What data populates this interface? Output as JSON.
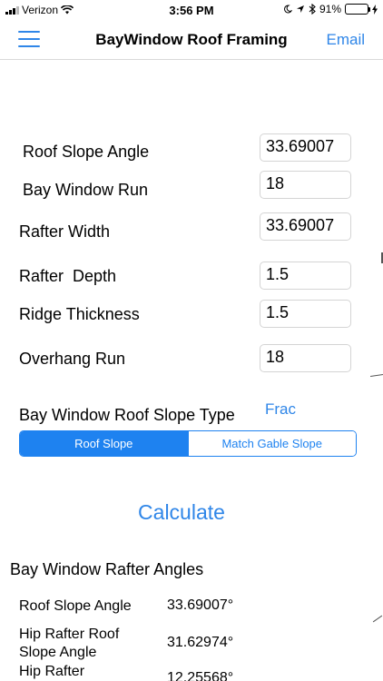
{
  "status_bar": {
    "carrier": "Verizon",
    "time": "3:56 PM",
    "battery": "91%",
    "battery_level": 0.91
  },
  "navbar": {
    "title": "BayWindow Roof Framing",
    "email_label": "Email",
    "menu_icon": "hamburger-menu-icon"
  },
  "inputs": {
    "roof_slope_angle": {
      "label": "Roof Slope Angle",
      "value": "33.69007"
    },
    "bay_window_run": {
      "label": "Bay Window Run",
      "value": "18"
    },
    "rafter_width": {
      "label": "Rafter Width",
      "value": "33.69007"
    },
    "rafter_depth": {
      "label": "Rafter  Depth",
      "value": "1.5"
    },
    "ridge_thickness": {
      "label": "Ridge Thickness",
      "value": "1.5"
    },
    "overhang_run": {
      "label": "Overhang Run",
      "value": "18"
    }
  },
  "slope_type": {
    "label": "Bay Window Roof Slope Type",
    "frac_label": "Frac",
    "options": [
      "Roof Slope",
      "Match Gable Slope"
    ],
    "selected": "Roof Slope"
  },
  "calculate_label": "Calculate",
  "results": {
    "heading": "Bay Window Rafter Angles",
    "rows": [
      {
        "label": "Roof Slope Angle",
        "value": "33.69007°"
      },
      {
        "label": "Hip Rafter Roof\nSlope Angle",
        "value": "31.62974°"
      },
      {
        "label": "Hip Rafter",
        "value": "12.25568°"
      }
    ]
  },
  "colors": {
    "accent": "#2f86e8",
    "segment_active": "#1e82f0",
    "battery": "#34c759"
  }
}
